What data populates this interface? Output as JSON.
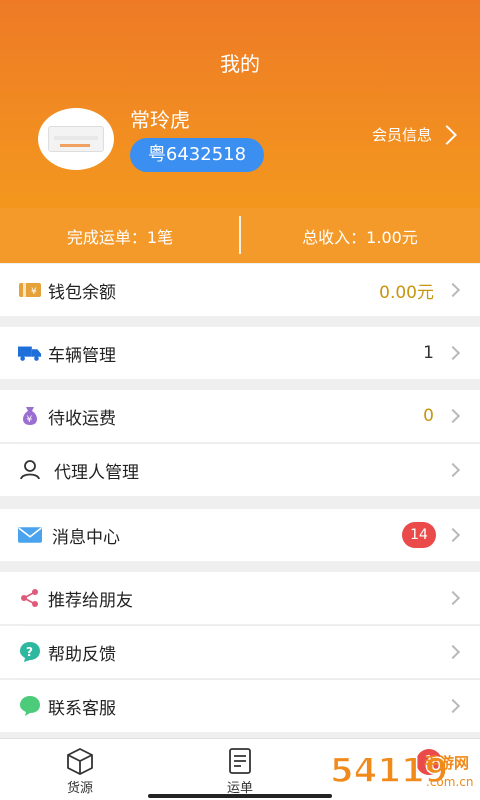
{
  "header": {
    "title": "我的",
    "user_name": "常玲虎",
    "plate": "粤6432518",
    "member_info": "会员信息"
  },
  "stats": {
    "completed": "完成运单：1笔",
    "income": "总收入：1.00元"
  },
  "menu": {
    "wallet": {
      "label": "钱包余额",
      "value": "0.00元"
    },
    "vehicle": {
      "label": "车辆管理",
      "value": "1"
    },
    "pending": {
      "label": "待收运费",
      "value": "0"
    },
    "agent": {
      "label": "代理人管理"
    },
    "messages": {
      "label": "消息中心",
      "badge": "14"
    },
    "recommend": {
      "label": "推荐给朋友"
    },
    "help": {
      "label": "帮助反馈"
    },
    "service": {
      "label": "联系客服"
    }
  },
  "tabbar": {
    "tabs": [
      {
        "label": "货源",
        "icon": "box-icon"
      },
      {
        "label": "运单",
        "icon": "waybill-icon"
      },
      {
        "label": "",
        "icon": "profile-icon",
        "badge": "1"
      }
    ]
  },
  "watermark": {
    "brand": "54119",
    "site_name": "手游网",
    "domain": ".com.cn"
  },
  "colors": {
    "header_orange": "#f29120",
    "plate_blue": "#3b8ff0",
    "value_gold": "#c8950f",
    "badge_red": "#ea4a4a"
  }
}
